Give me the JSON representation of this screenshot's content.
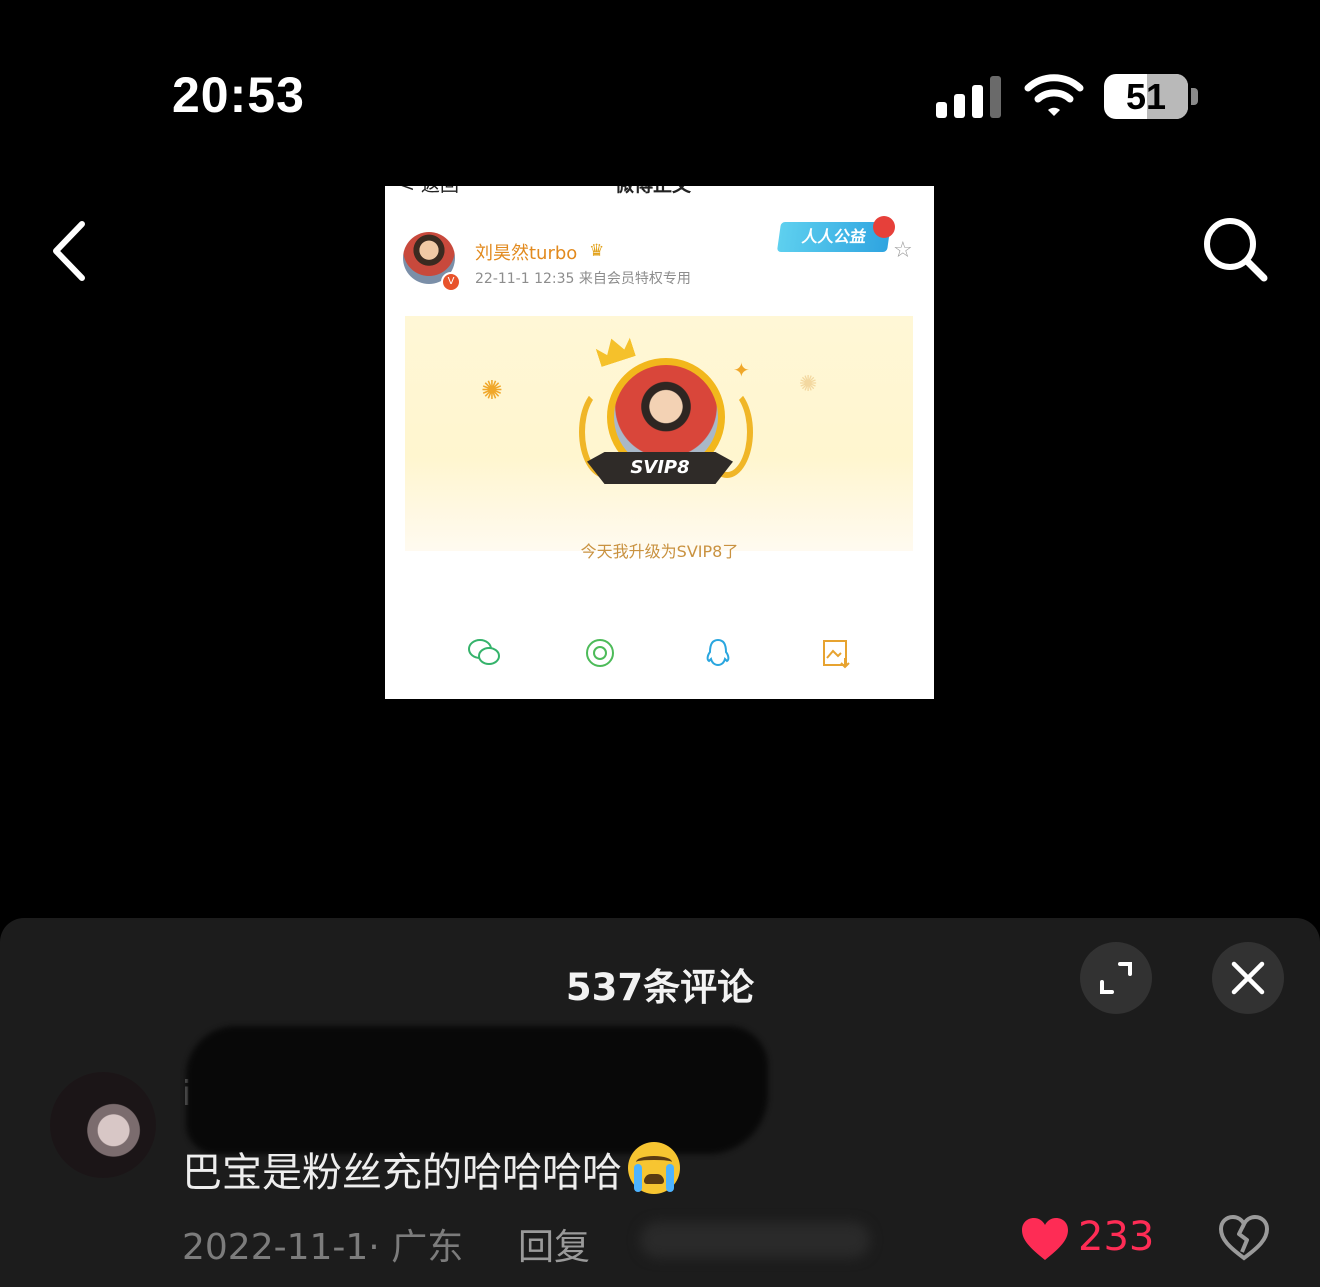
{
  "status_bar": {
    "time": "20:53",
    "battery": "51",
    "signal_icon": "cellular-signal-icon",
    "wifi_icon": "wifi-icon"
  },
  "nav": {
    "back_icon": "back-chevron-icon",
    "search_icon": "search-icon"
  },
  "embedded_post": {
    "top_back": "< 返回",
    "top_title": "微博正文",
    "top_more": "···",
    "user_name": "刘昊然turbo",
    "post_meta": "22-11-1 12:35  来自会员特权专用",
    "badge_text": "人人公益",
    "ribbon_text": "SVIP8",
    "caption": "今天我升级为SVIP8了",
    "share_icons": [
      "wechat-icon",
      "moments-icon",
      "qq-icon",
      "save-image-icon"
    ]
  },
  "comments": {
    "title": "537条评论",
    "expand_icon": "expand-icon",
    "close_icon": "close-icon",
    "items": [
      {
        "user": "i",
        "text": "巴宝是粉丝充的哈哈哈哈",
        "meta": "2022-11-1· 广东",
        "reply": "回复",
        "likes": "233",
        "like_color": "#fe2c55"
      }
    ]
  }
}
